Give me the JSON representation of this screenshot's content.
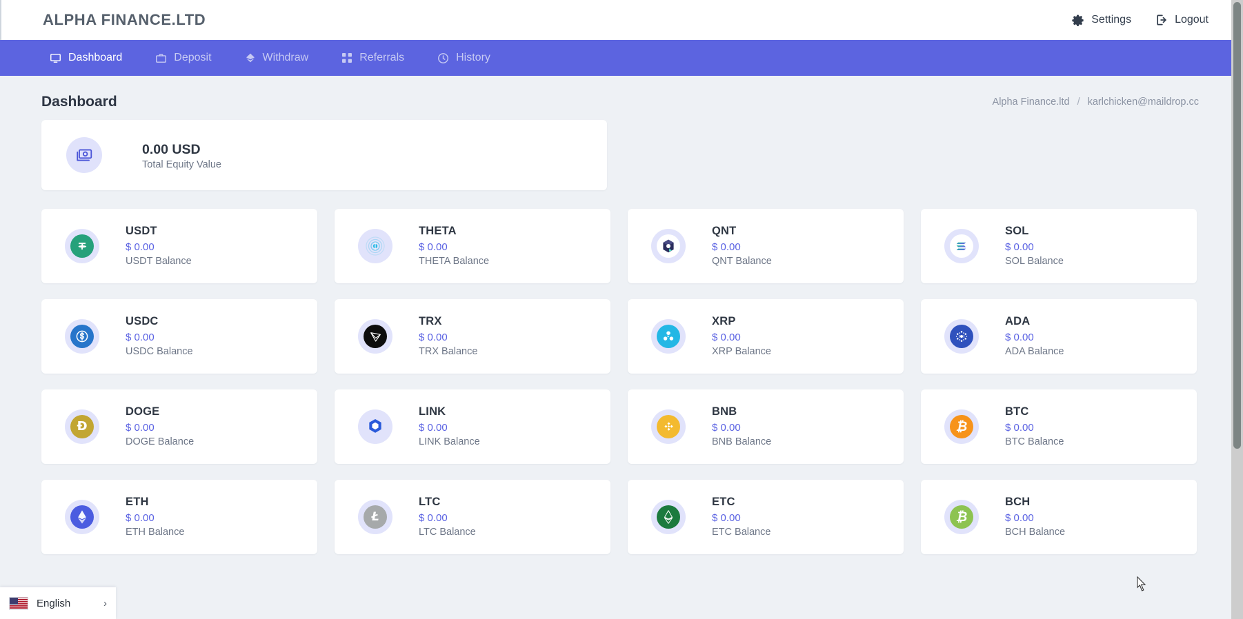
{
  "header": {
    "brand": "ALPHA FINANCE.LTD",
    "settings_label": "Settings",
    "settings_icon": "gear-icon",
    "logout_label": "Logout",
    "logout_icon": "logout-icon"
  },
  "nav": {
    "items": [
      {
        "label": "Dashboard",
        "icon": "monitor-icon",
        "active": true
      },
      {
        "label": "Deposit",
        "icon": "briefcase-icon",
        "active": false
      },
      {
        "label": "Withdraw",
        "icon": "diamond-icon",
        "active": false
      },
      {
        "label": "Referrals",
        "icon": "share-nodes-icon",
        "active": false
      },
      {
        "label": "History",
        "icon": "clock-icon",
        "active": false
      }
    ],
    "accent": "#5c64e0"
  },
  "page": {
    "title": "Dashboard",
    "breadcrumb": {
      "root": "Alpha Finance.ltd",
      "separator": "/",
      "current": "karlchicken@maildrop.cc"
    }
  },
  "equity": {
    "amount": "0.00 USD",
    "label": "Total Equity Value",
    "icon": "money-stack-icon"
  },
  "coins": [
    {
      "symbol": "USDT",
      "amount": "$ 0.00",
      "label": "USDT Balance",
      "icon": "usdt-icon",
      "color": "#26a17b"
    },
    {
      "symbol": "THETA",
      "amount": "$ 0.00",
      "label": "THETA Balance",
      "icon": "theta-icon",
      "color": "#2ab8e6"
    },
    {
      "symbol": "QNT",
      "amount": "$ 0.00",
      "label": "QNT Balance",
      "icon": "qnt-icon",
      "color": "#2b2d5c"
    },
    {
      "symbol": "SOL",
      "amount": "$ 0.00",
      "label": "SOL Balance",
      "icon": "sol-icon",
      "color": "#14f195"
    },
    {
      "symbol": "USDC",
      "amount": "$ 0.00",
      "label": "USDC Balance",
      "icon": "usdc-icon",
      "color": "#2775ca"
    },
    {
      "symbol": "TRX",
      "amount": "$ 0.00",
      "label": "TRX Balance",
      "icon": "trx-icon",
      "color": "#0d0d0d"
    },
    {
      "symbol": "XRP",
      "amount": "$ 0.00",
      "label": "XRP Balance",
      "icon": "xrp-icon",
      "color": "#23b7e5"
    },
    {
      "symbol": "ADA",
      "amount": "$ 0.00",
      "label": "ADA Balance",
      "icon": "ada-icon",
      "color": "#2f51bd"
    },
    {
      "symbol": "DOGE",
      "amount": "$ 0.00",
      "label": "DOGE Balance",
      "icon": "doge-icon",
      "color": "#c2a633"
    },
    {
      "symbol": "LINK",
      "amount": "$ 0.00",
      "label": "LINK Balance",
      "icon": "link-icon",
      "color": "#2a5ada"
    },
    {
      "symbol": "BNB",
      "amount": "$ 0.00",
      "label": "BNB Balance",
      "icon": "bnb-icon",
      "color": "#f3ba2f"
    },
    {
      "symbol": "BTC",
      "amount": "$ 0.00",
      "label": "BTC Balance",
      "icon": "btc-icon",
      "color": "#f7931a"
    },
    {
      "symbol": "ETH",
      "amount": "$ 0.00",
      "label": "ETH Balance",
      "icon": "eth-icon",
      "color": "#4b5ce0"
    },
    {
      "symbol": "LTC",
      "amount": "$ 0.00",
      "label": "LTC Balance",
      "icon": "ltc-icon",
      "color": "#a6a9aa"
    },
    {
      "symbol": "ETC",
      "amount": "$ 0.00",
      "label": "ETC Balance",
      "icon": "etc-icon",
      "color": "#1c7a3e"
    },
    {
      "symbol": "BCH",
      "amount": "$ 0.00",
      "label": "BCH Balance",
      "icon": "bch-icon",
      "color": "#8dc351"
    }
  ],
  "language": {
    "label": "English",
    "flag_icon": "us-flag-icon",
    "chevron_icon": "chevron-right-icon",
    "chevron_glyph": "›"
  }
}
